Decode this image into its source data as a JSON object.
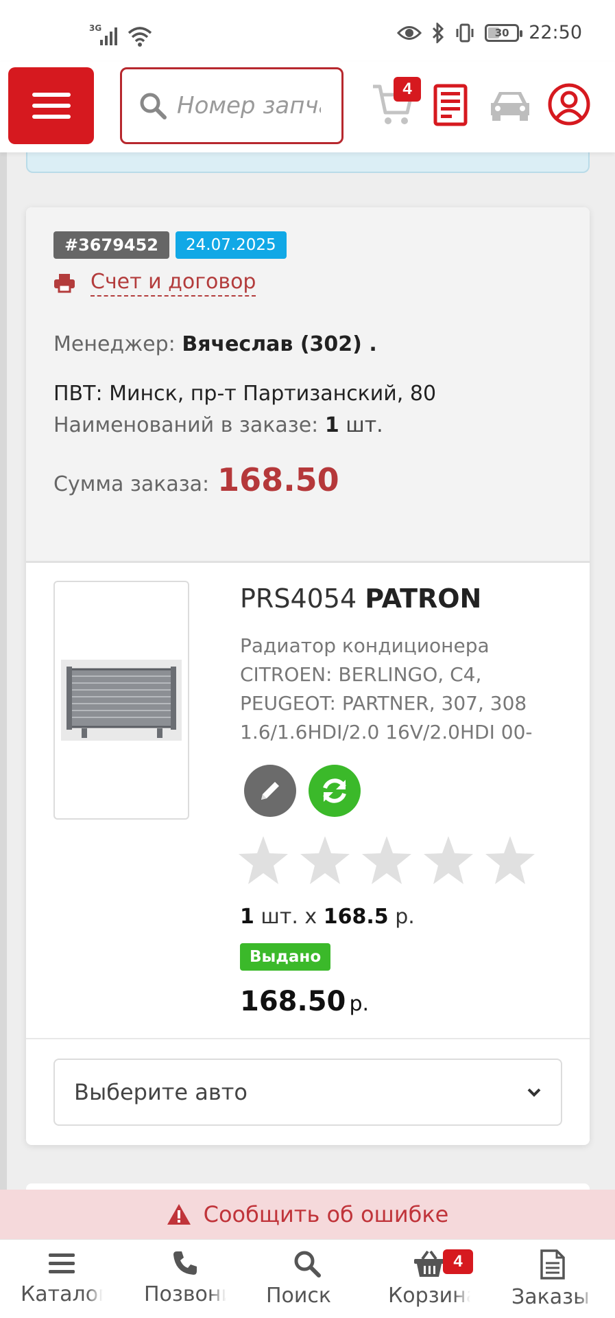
{
  "status_bar": {
    "network": "3G",
    "battery": "30",
    "time": "22:50"
  },
  "header": {
    "search_placeholder": "Номер запчасти",
    "cart_count": "4"
  },
  "order": {
    "id": "#3679452",
    "date": "24.07.2025",
    "invoice_link": "Счет и договор",
    "manager_label": "Менеджер:",
    "manager_value": "Вячеслав (302) .",
    "pvt_text": "ПВТ: Минск, пр-т Партизанский, 80",
    "items_label": "Наименований в заказе:",
    "items_value": "1",
    "items_unit": "шт.",
    "sum_label": "Сумма заказа:",
    "sum_value": "168.50"
  },
  "product": {
    "code": "PRS4054",
    "brand": "PATRON",
    "description": "Радиатор кондиционера CITROEN: BERLINGO, C4, PEUGEOT: PARTNER, 307, 308 1.6/1.6HDI/2.0 16V/2.0HDI 00-",
    "rating": 0,
    "rating_max": 5,
    "qty": "1",
    "qty_unit": "шт. x",
    "price": "168.5",
    "price_unit": "р.",
    "status": "Выдано",
    "total": "168.50",
    "total_unit": "р."
  },
  "car_select": {
    "placeholder": "Выберите авто"
  },
  "report_error": "Сообщить об ошибке",
  "bottom_nav": [
    {
      "label": "Каталог",
      "icon": "bars-icon"
    },
    {
      "label": "Позвонить",
      "icon": "phone-icon"
    },
    {
      "label": "Поиск",
      "icon": "search-icon"
    },
    {
      "label": "Корзина",
      "icon": "basket-icon",
      "badge": "4"
    },
    {
      "label": "Заказы",
      "icon": "document-icon"
    }
  ],
  "colors": {
    "brand_red": "#d6191f",
    "accent_blue": "#11a8e6",
    "success_green": "#3bb92a",
    "price_red": "#b5383a"
  }
}
